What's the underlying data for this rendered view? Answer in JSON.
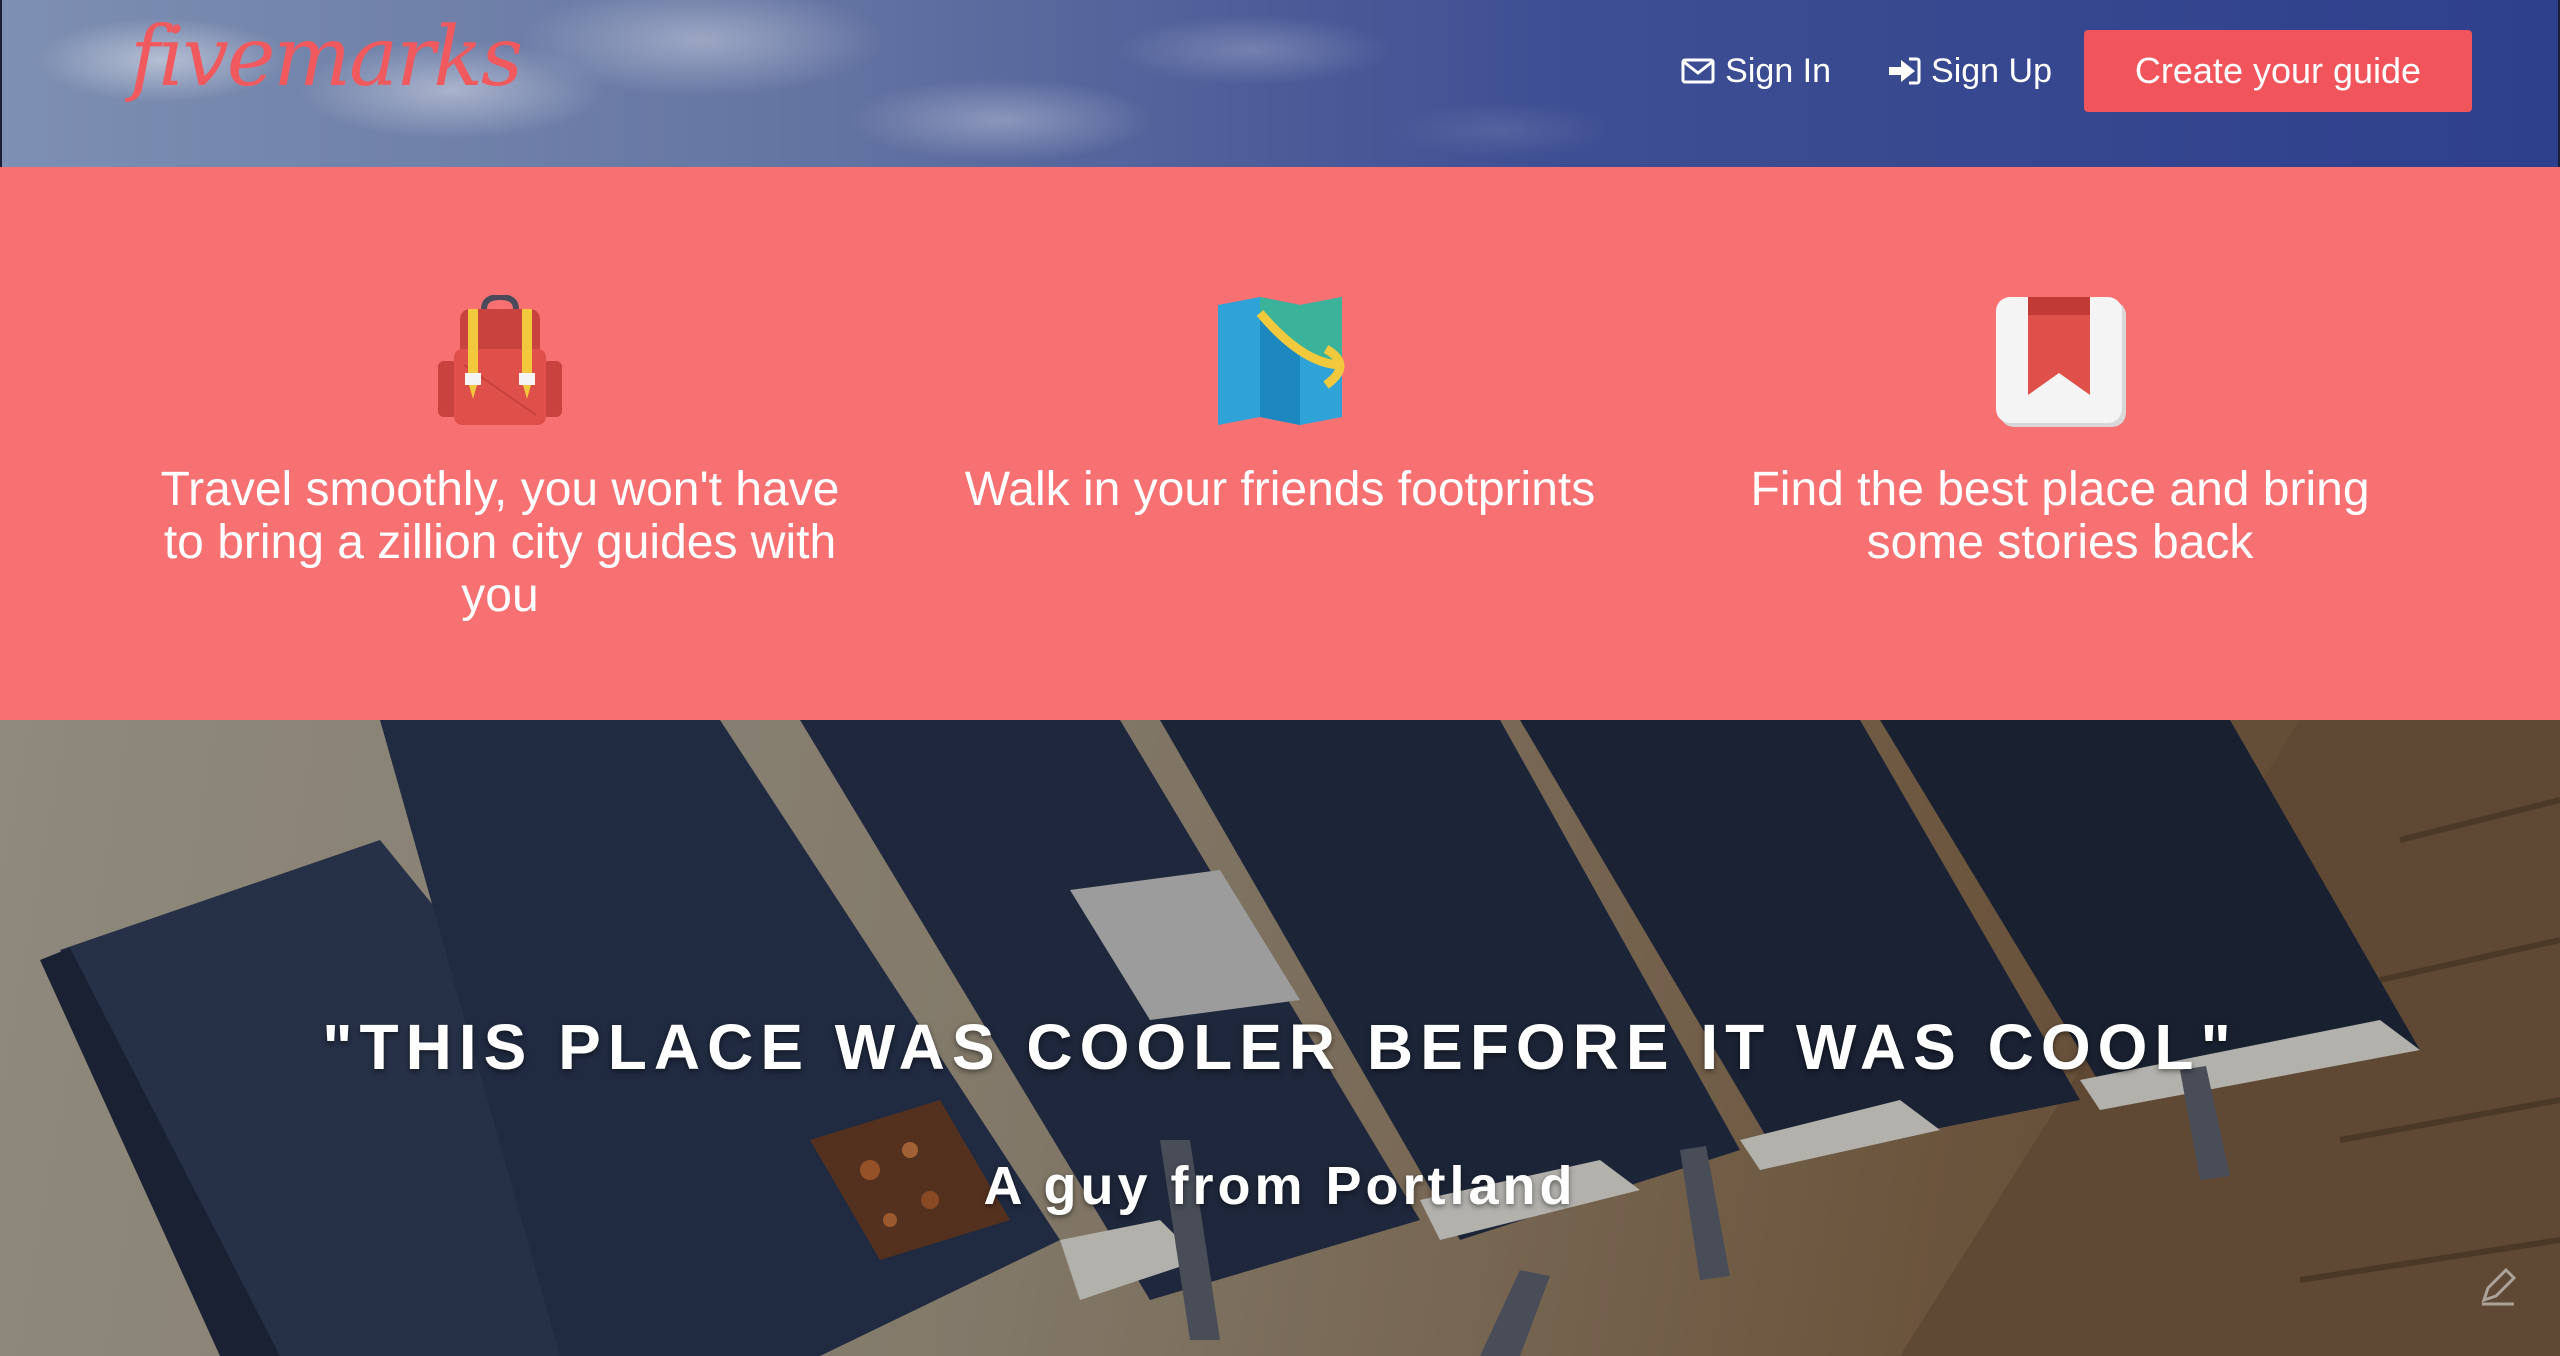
{
  "header": {
    "logo": "fivemarks",
    "nav": {
      "sign_in": "Sign In",
      "sign_up": "Sign Up",
      "create_guide": "Create your guide"
    }
  },
  "features": [
    {
      "icon": "backpack-icon",
      "text": "Travel smoothly, you won't have to bring a zillion city guides with you"
    },
    {
      "icon": "map-icon",
      "text": "Walk in your friends footprints"
    },
    {
      "icon": "bookmark-icon",
      "text": "Find the best place and bring some stories back"
    }
  ],
  "hero": {
    "quote": "\"THIS PLACE WAS COOLER BEFORE IT WAS COOL\"",
    "author": "A guy from Portland"
  },
  "colors": {
    "brand": "#f05a5f",
    "cta": "#f2545b",
    "features_band": "#f77173"
  }
}
